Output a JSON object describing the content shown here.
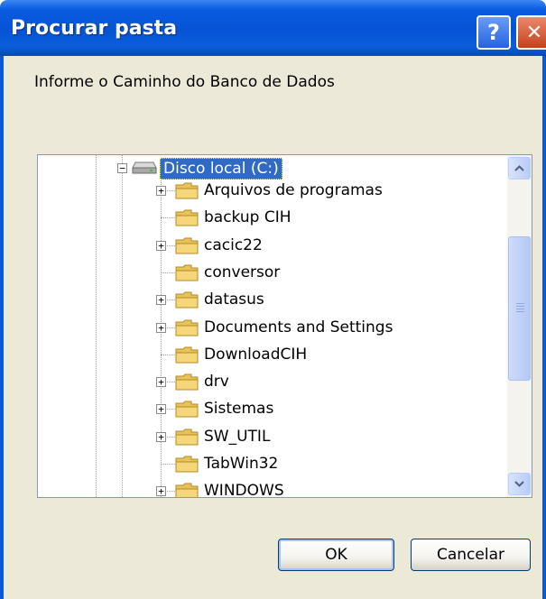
{
  "window": {
    "title": "Procurar pasta",
    "help_glyph": "?",
    "close_glyph": "✕"
  },
  "prompt": "Informe o Caminho do Banco de Dados",
  "tree": {
    "root": {
      "label": "Disco local (C:)",
      "icon": "hard-drive-icon",
      "expanded": true,
      "selected": true
    },
    "items": [
      {
        "label": "Arquivos de programas",
        "has_children": true,
        "icon": "folder-icon"
      },
      {
        "label": "backup CIH",
        "has_children": false,
        "icon": "folder-icon"
      },
      {
        "label": "cacic22",
        "has_children": true,
        "icon": "folder-icon"
      },
      {
        "label": "conversor",
        "has_children": false,
        "icon": "folder-icon"
      },
      {
        "label": "datasus",
        "has_children": true,
        "icon": "folder-icon"
      },
      {
        "label": "Documents and Settings",
        "has_children": true,
        "icon": "folder-icon"
      },
      {
        "label": "DownloadCIH",
        "has_children": false,
        "icon": "folder-icon"
      },
      {
        "label": "drv",
        "has_children": true,
        "icon": "folder-icon"
      },
      {
        "label": "Sistemas",
        "has_children": true,
        "icon": "folder-icon"
      },
      {
        "label": "SW_UTIL",
        "has_children": true,
        "icon": "folder-icon"
      },
      {
        "label": "TabWin32",
        "has_children": false,
        "icon": "folder-icon"
      },
      {
        "label": "WINDOWS",
        "has_children": true,
        "icon": "folder-icon"
      }
    ]
  },
  "buttons": {
    "ok": "OK",
    "cancel": "Cancelar"
  },
  "colors": {
    "title_bar": "#0653d4",
    "selection": "#316ac5",
    "dialog_bg": "#ece9d8",
    "folder": "#f5d77a"
  }
}
